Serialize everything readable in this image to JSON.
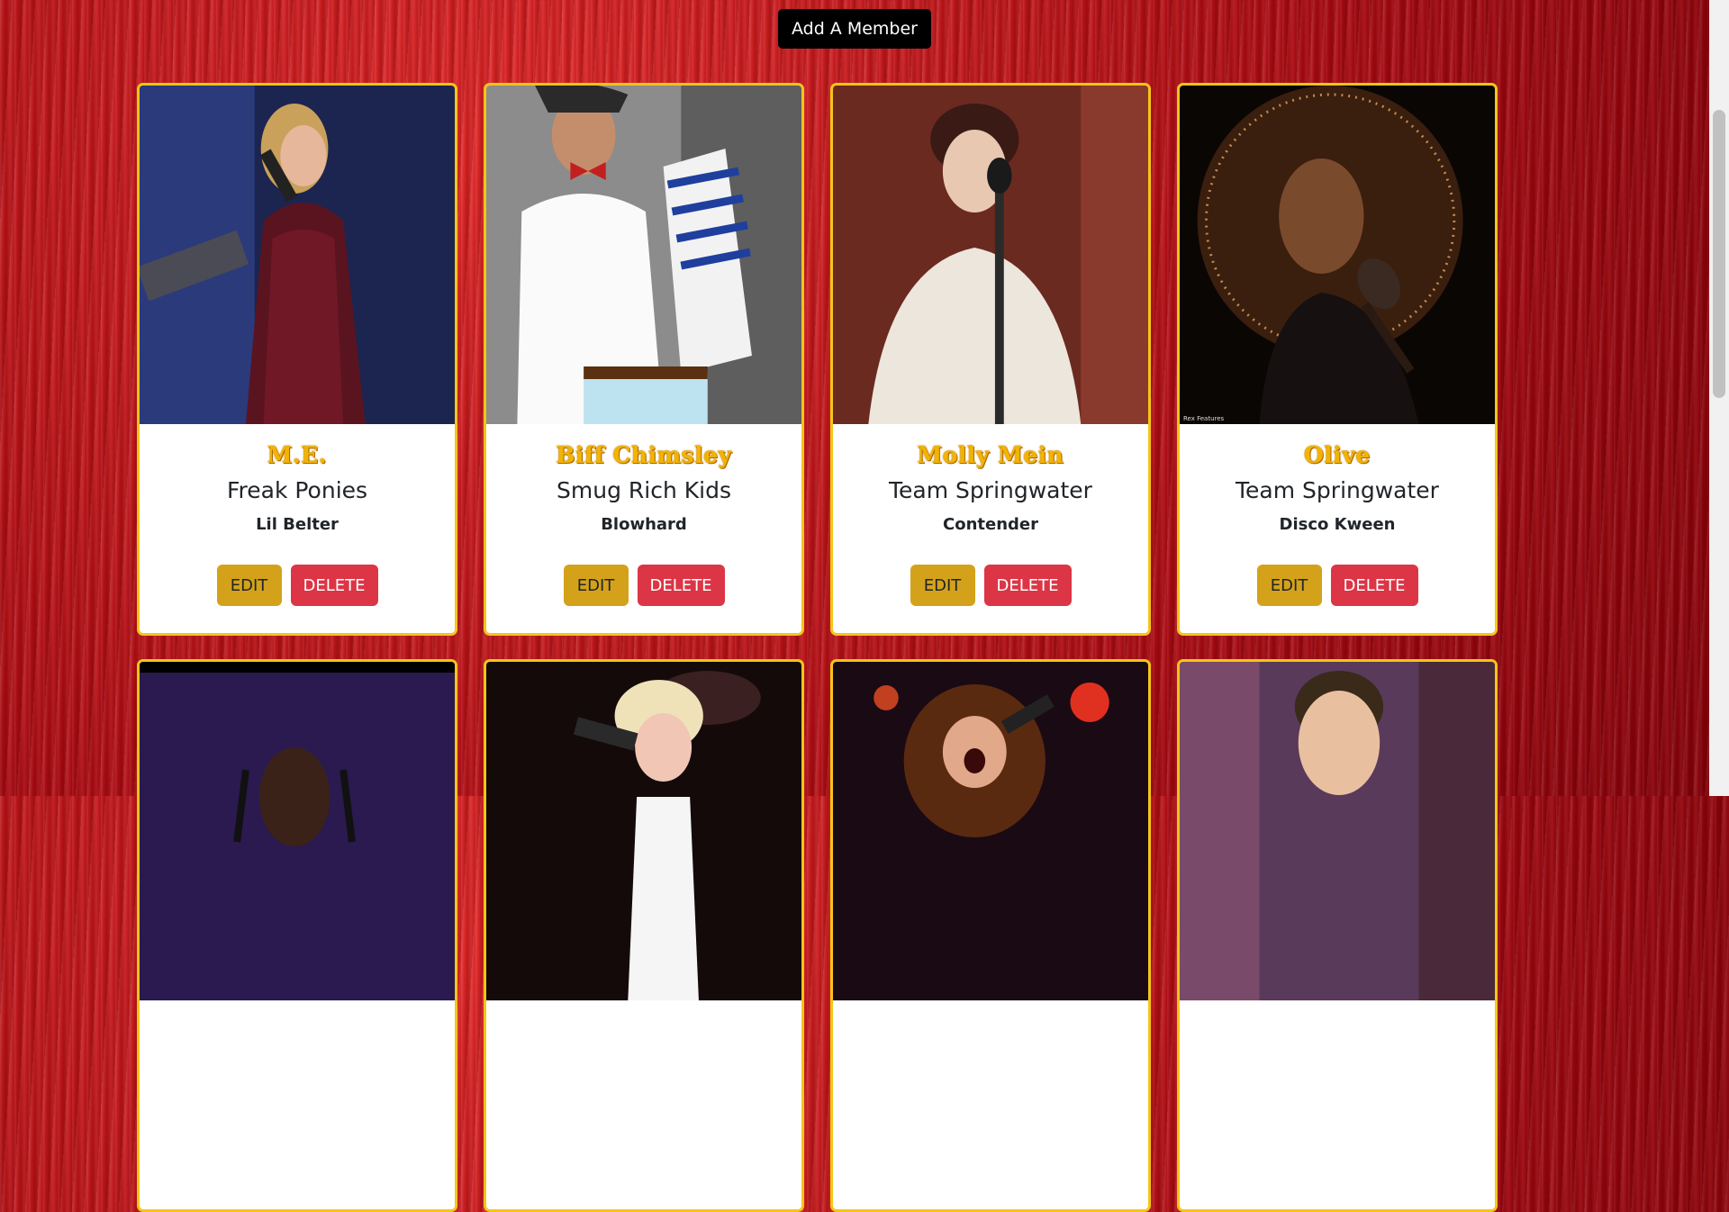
{
  "header": {
    "add_member_label": "Add A Member"
  },
  "actions": {
    "edit_label": "EDIT",
    "delete_label": "DELETE"
  },
  "members": [
    {
      "name": "M.E.",
      "team": "Freak Ponies",
      "role": "Lil Belter"
    },
    {
      "name": "Biff Chimsley",
      "team": "Smug Rich Kids",
      "role": "Blowhard"
    },
    {
      "name": "Molly Mein",
      "team": "Team Springwater",
      "role": "Contender"
    },
    {
      "name": "Olive",
      "team": "Team Springwater",
      "role": "Disco Kween"
    },
    {
      "name": "",
      "team": "",
      "role": ""
    },
    {
      "name": "",
      "team": "",
      "role": ""
    },
    {
      "name": "",
      "team": "",
      "role": ""
    },
    {
      "name": "",
      "team": "",
      "role": ""
    }
  ],
  "photo_credit": "Rex Features",
  "colors": {
    "card_border": "#f5c518",
    "edit": "#d4a21a",
    "delete": "#dc3545",
    "name_gold": "#f2b400"
  }
}
